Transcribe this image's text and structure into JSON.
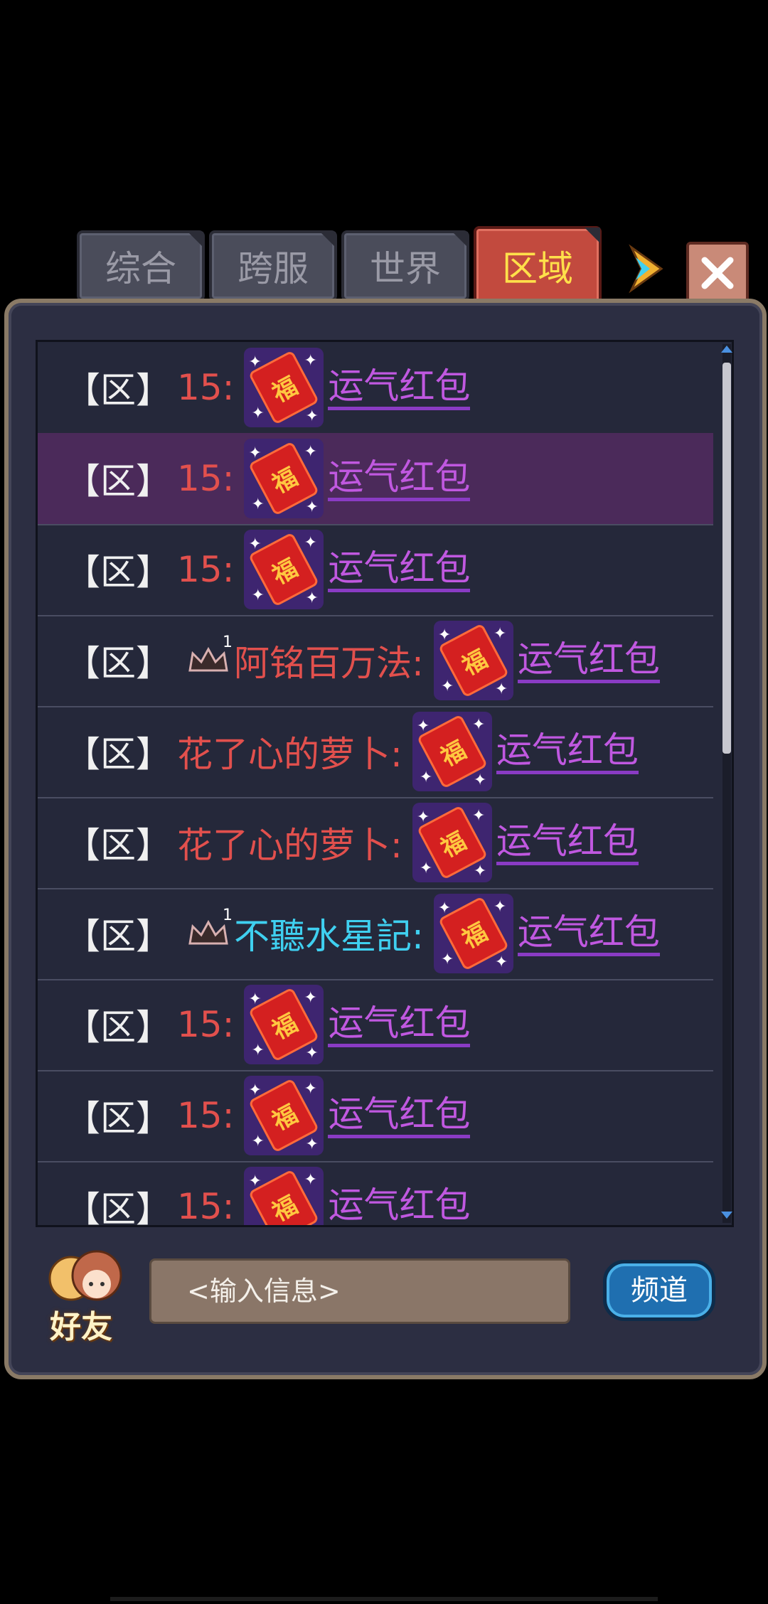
{
  "tabs": [
    {
      "label": "综合",
      "active": false
    },
    {
      "label": "跨服",
      "active": false
    },
    {
      "label": "世界",
      "active": false
    },
    {
      "label": "区域",
      "active": true
    }
  ],
  "messages": [
    {
      "tag": "【区】",
      "sender": "15:",
      "crown": false,
      "link": "运气红包",
      "highlighted": false
    },
    {
      "tag": "【区】",
      "sender": "15:",
      "crown": false,
      "link": "运气红包",
      "highlighted": true
    },
    {
      "tag": "【区】",
      "sender": "15:",
      "crown": false,
      "link": "运气红包",
      "highlighted": false
    },
    {
      "tag": "【区】",
      "sender": "阿铭百万法:",
      "crown": true,
      "crown_level": "1",
      "link": "运气红包",
      "highlighted": false
    },
    {
      "tag": "【区】",
      "sender": "花了心的萝卜:",
      "crown": false,
      "link": "运气红包",
      "highlighted": false
    },
    {
      "tag": "【区】",
      "sender": "花了心的萝卜:",
      "crown": false,
      "link": "运气红包",
      "highlighted": false
    },
    {
      "tag": "【区】",
      "sender": "不聽水星記:",
      "crown": true,
      "crown_level": "1",
      "sender_color": "cyan",
      "link": "运气红包",
      "highlighted": false
    },
    {
      "tag": "【区】",
      "sender": "15:",
      "crown": false,
      "link": "运气红包",
      "highlighted": false
    },
    {
      "tag": "【区】",
      "sender": "15:",
      "crown": false,
      "link": "运气红包",
      "highlighted": false
    },
    {
      "tag": "【区】",
      "sender": "15:",
      "crown": false,
      "link": "运气红包",
      "highlighted": false
    }
  ],
  "packet_glyph": "福",
  "friend_label": "好友",
  "input_placeholder": "<输入信息>",
  "channel_label": "频道",
  "colors": {
    "accent_tab": "#c24a3e",
    "link": "#c058e0",
    "sender": "#e2504d",
    "sender_cyan": "#3fd0f0"
  }
}
